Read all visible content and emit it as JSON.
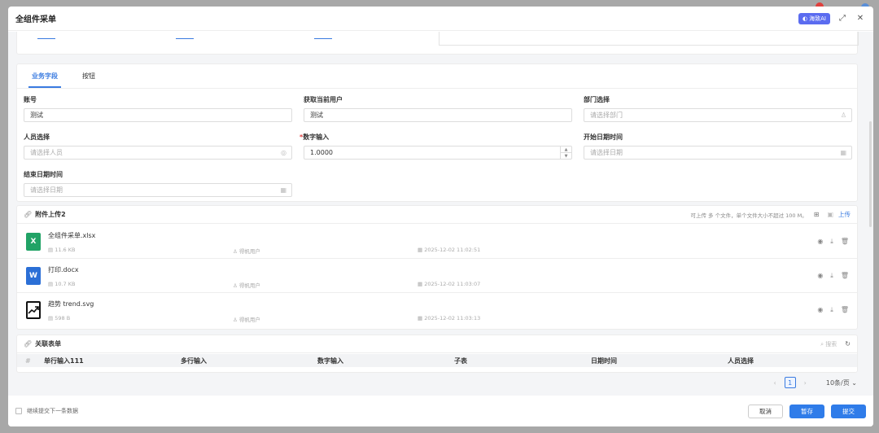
{
  "modal": {
    "title": "全组件采单",
    "ai_label": "海致AI"
  },
  "tabs": [
    "业务字段",
    "按钮"
  ],
  "fields": {
    "account": {
      "label": "账号",
      "value": "测试"
    },
    "current_user": {
      "label": "获取当前用户",
      "value": "测试"
    },
    "dept": {
      "label": "部门选择",
      "placeholder": "请选择部门"
    },
    "person": {
      "label": "人员选择",
      "placeholder": "请选择人员"
    },
    "number": {
      "required": "*",
      "label": "数字输入",
      "value": "1.0000"
    },
    "start_datetime": {
      "label": "开始日期时间",
      "placeholder": "请选择日期"
    },
    "end_datetime": {
      "label": "结束日期时间",
      "placeholder": "请选择日期"
    }
  },
  "attachments": {
    "title": "附件上传2",
    "hint": "可上传 多 个文件，单个文件大小不超过 100 M。",
    "upload_label": "上传",
    "files": [
      {
        "name": "全组件采单.xlsx",
        "size": "11.6 KB",
        "user": "得帆用户",
        "time": "2025-12-02 11:02:51",
        "type": "X",
        "color": "#21a366"
      },
      {
        "name": "打印.docx",
        "size": "10.7 KB",
        "user": "得帆用户",
        "time": "2025-12-02 11:03:07",
        "type": "W",
        "color": "#2b6fd6"
      },
      {
        "name": "趋势 trend.svg",
        "size": "598 B",
        "user": "得帆用户",
        "time": "2025-12-02 11:03:13",
        "type": "svg",
        "color": "#111111"
      }
    ]
  },
  "related": {
    "title": "关联表单",
    "search_label": "搜索",
    "columns": [
      "#",
      "单行输入111",
      "多行输入",
      "数字输入",
      "子表",
      "日期时间",
      "人员选择"
    ]
  },
  "pager": {
    "page": "1",
    "page_size": "10条/页"
  },
  "footer": {
    "continue_label": "继续提交下一条数据",
    "cancel": "取消",
    "save": "暂存",
    "submit": "提交"
  }
}
